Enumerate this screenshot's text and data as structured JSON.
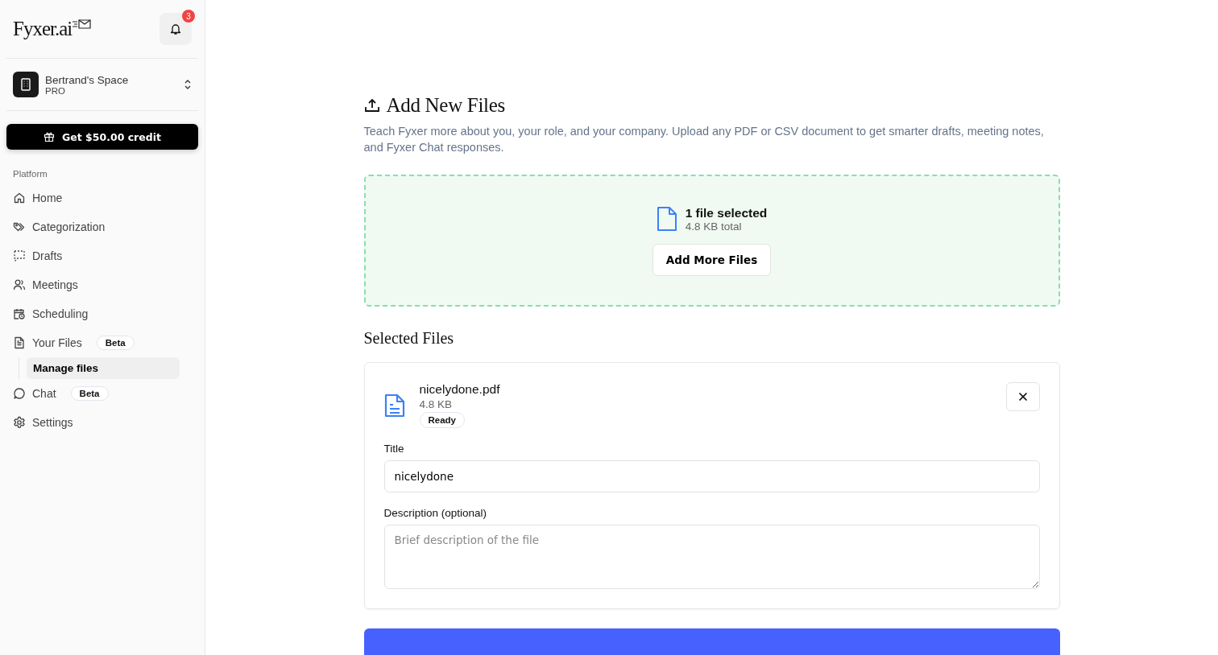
{
  "sidebar": {
    "logo": "Fyxer.ai",
    "notification_count": "3",
    "workspace": {
      "name": "Bertrand's Space",
      "plan": "PRO"
    },
    "credit_button": "Get $50.00 credit",
    "section": "Platform",
    "items": [
      {
        "kind": "home",
        "label": "Home",
        "selected": false
      },
      {
        "kind": "tag",
        "label": "Categorization",
        "selected": false
      },
      {
        "kind": "drafts",
        "label": "Drafts",
        "selected": false
      },
      {
        "kind": "people",
        "label": "Meetings",
        "selected": false
      },
      {
        "kind": "calendar",
        "label": "Scheduling",
        "selected": false
      },
      {
        "kind": "file",
        "label": "Your Files",
        "badge": "Beta",
        "selected": false,
        "expanded": true,
        "children": [
          {
            "label": "Manage files",
            "selected": true
          }
        ]
      },
      {
        "kind": "chat",
        "label": "Chat",
        "badge": "Beta",
        "selected": false
      },
      {
        "kind": "gear",
        "label": "Settings",
        "selected": false
      }
    ]
  },
  "main": {
    "title": "Add New Files",
    "description": "Teach Fyxer more about you, your role, and your company. Upload any PDF or CSV document to get smarter drafts, meeting notes, and Fyxer Chat responses.",
    "dropzone": {
      "title": "1 file selected",
      "subtitle": "4.8 KB total",
      "button": "Add More Files"
    },
    "selected_heading": "Selected Files",
    "files": [
      {
        "name": "nicelydone.pdf",
        "size": "4.8 KB",
        "status": "Ready",
        "title_label": "Title",
        "title_value": "nicelydone",
        "description_label": "Description (optional)",
        "description_placeholder": "Brief description of the file"
      }
    ]
  }
}
